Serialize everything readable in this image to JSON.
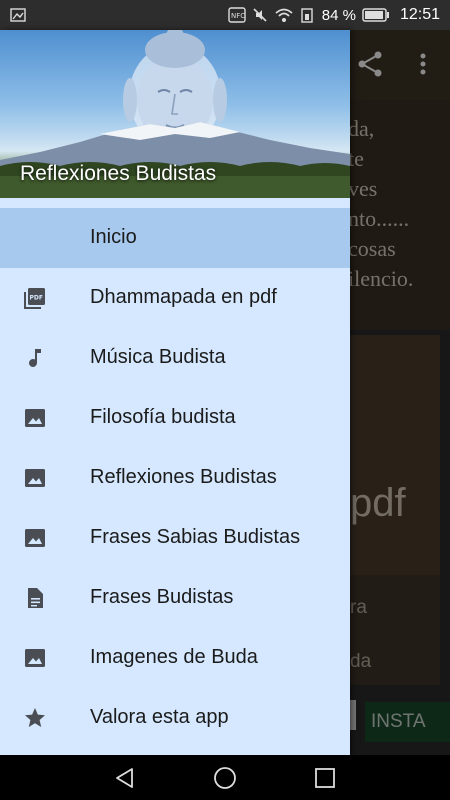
{
  "status_bar": {
    "battery_percent": "84",
    "percent_sign": "%",
    "time": "12:51"
  },
  "drawer": {
    "header_title": "Reflexiones Budistas",
    "items": [
      {
        "label": "Inicio",
        "icon": "home",
        "selected": true
      },
      {
        "label": "Dhammapada en pdf",
        "icon": "pdf-icon"
      },
      {
        "label": "Música Budista",
        "icon": "music-note-icon"
      },
      {
        "label": "Filosofía budista",
        "icon": "image-icon"
      },
      {
        "label": "Reflexiones Budistas",
        "icon": "image-icon"
      },
      {
        "label": "Frases Sabias Budistas",
        "icon": "image-icon"
      },
      {
        "label": "Frases Budistas",
        "icon": "document-icon"
      },
      {
        "label": "Imagenes de Buda",
        "icon": "image-icon"
      },
      {
        "label": "Valora esta app",
        "icon": "star-icon"
      }
    ]
  },
  "background": {
    "quote_lines": [
      "da,",
      "te",
      "ves",
      "nto......",
      "cosas",
      "ilencio."
    ],
    "card_pdf_text": "pdf",
    "card_line1": "ra",
    "card_line2": "da",
    "install_label": "INSTA"
  },
  "colors": {
    "drawer_bg": "#d5e8ff",
    "selected_bg": "#a7c9ee",
    "status_bar": "#2d2d2d"
  }
}
